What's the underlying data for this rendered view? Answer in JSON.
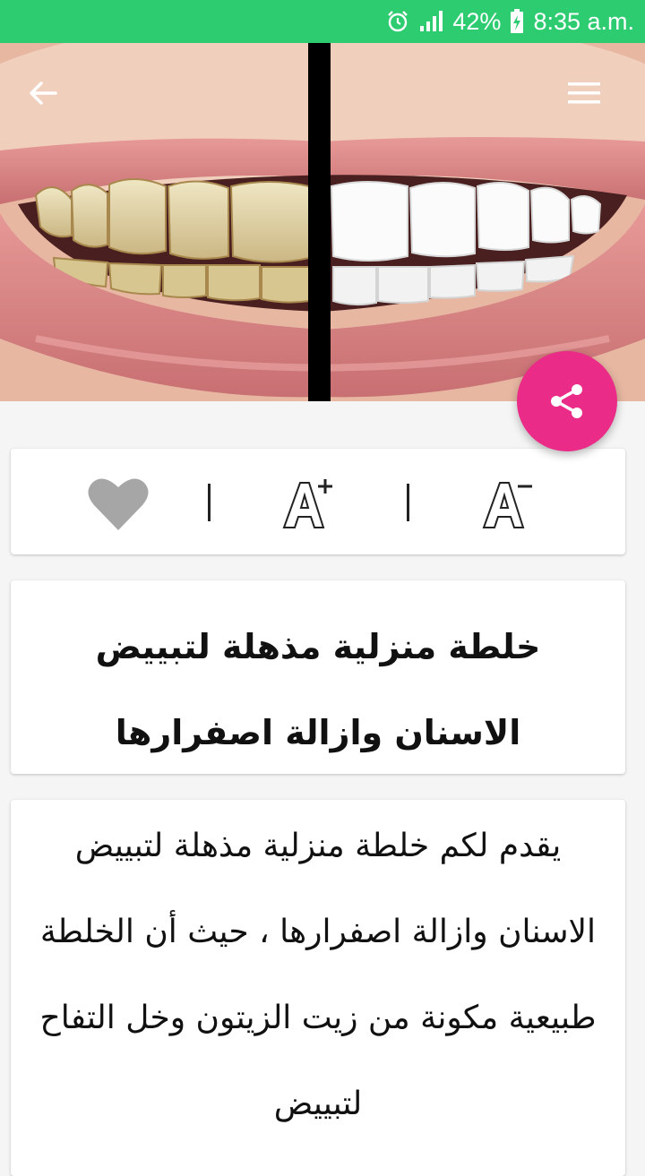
{
  "status_bar": {
    "battery": "42%",
    "time": "8:35 a.m.",
    "icons": [
      "alarm-icon",
      "signal-icon",
      "battery-charging-icon"
    ],
    "color": "#2ecc71"
  },
  "toolbar": {
    "back_icon": "arrow-back-icon",
    "menu_icon": "hamburger-menu-icon"
  },
  "share_button": {
    "icon": "share-icon",
    "color": "#ea2c88"
  },
  "actions": {
    "favorite_icon": "heart-icon",
    "increase_font": "A+",
    "decrease_font": "A-"
  },
  "article": {
    "title": "خلطة منزلية مذهلة لتبييض الاسنان وازالة اصفرارها",
    "body": "يقدم لكم خلطة منزلية مذهلة لتبييض الاسنان وازالة اصفرارها ، حيث أن الخلطة طبيعية مكونة من زيت الزيتون وخل التفاح لتبييض"
  }
}
